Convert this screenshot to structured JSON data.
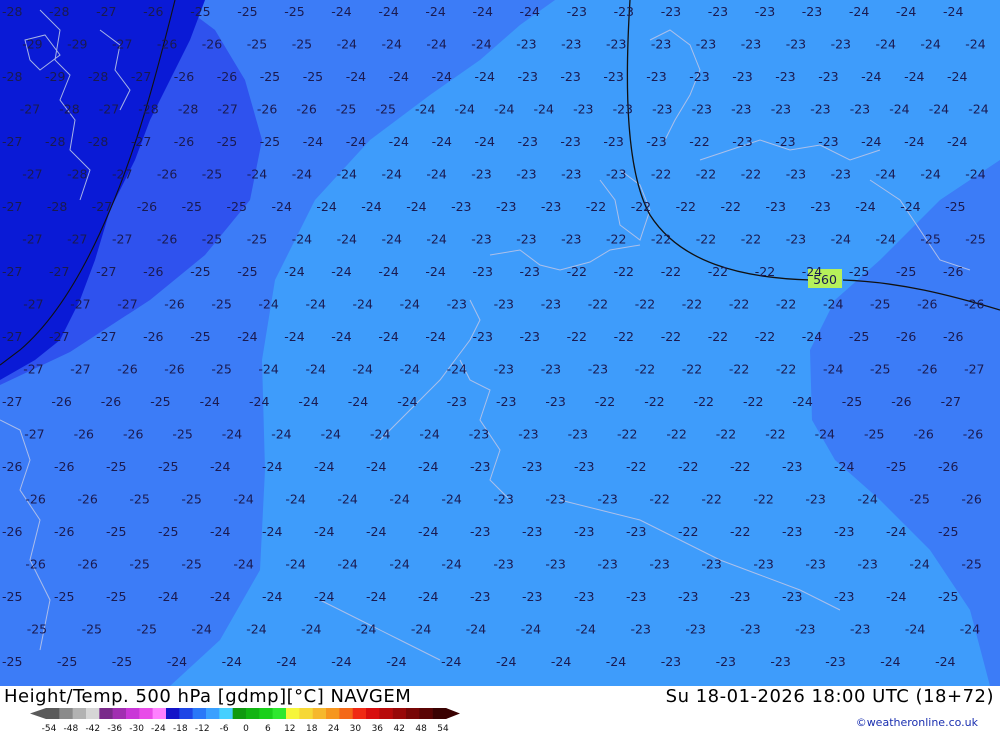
{
  "title_left": "Height/Temp. 500 hPa [gdmp][°C] NAVGEM",
  "title_right": "Su 18-01-2026 18:00 UTC (18+72)",
  "credit": "©weatheronline.co.uk",
  "height_contour_label": "560",
  "colors": {
    "ocean_dark": "#0a1ad6",
    "zone_m27": "#2f52ee",
    "zone_m24": "#3c7cf7",
    "zone_m22": "#3e9cfb",
    "contour": "#1a1a50",
    "coast": "#b8c4e8",
    "height_label_bg": "#b6f05a"
  },
  "legend": {
    "colors": [
      "#5a5a5a",
      "#8a8a8a",
      "#b2b2b2",
      "#d6d6d6",
      "#7a2a8a",
      "#a12eb1",
      "#c936d7",
      "#e84ce8",
      "#ff80ff",
      "#1414c8",
      "#1e46e6",
      "#2a78f8",
      "#3aa0ff",
      "#46d0ff",
      "#109a10",
      "#12b412",
      "#1ad01a",
      "#2ee82e",
      "#f6f63a",
      "#f6d836",
      "#f6b82c",
      "#f6961e",
      "#f46818",
      "#f02a14",
      "#d80e0e",
      "#b80a0a",
      "#980808",
      "#780606",
      "#5a0404",
      "#3a0202"
    ],
    "ticks": [
      "-54",
      "-48",
      "-42",
      "-36",
      "-30",
      "-24",
      "-18",
      "-12",
      "-6",
      "0",
      "6",
      "12",
      "18",
      "24",
      "30",
      "36",
      "42",
      "48",
      "54"
    ]
  },
  "temperature_labels": [
    {
      "row": 0,
      "values": [
        "-28",
        "-28",
        "-27",
        "-26",
        "-25",
        "-25",
        "-25",
        "-24",
        "-24",
        "-24",
        "-24",
        "-24",
        "-23",
        "-23",
        "-23",
        "-23",
        "-23",
        "-23",
        "-24",
        "-24",
        "-24"
      ]
    },
    {
      "row": 1,
      "values": [
        "-29",
        "-29",
        "-27",
        "-26",
        "-26",
        "-25",
        "-25",
        "-24",
        "-24",
        "-24",
        "-24",
        "-23",
        "-23",
        "-23",
        "-23",
        "-23",
        "-23",
        "-23",
        "-23",
        "-24",
        "-24",
        "-24"
      ]
    },
    {
      "row": 2,
      "values": [
        "-28",
        "-29",
        "-28",
        "-27",
        "-26",
        "-26",
        "-25",
        "-25",
        "-24",
        "-24",
        "-24",
        "-24",
        "-23",
        "-23",
        "-23",
        "-23",
        "-23",
        "-23",
        "-23",
        "-23",
        "-24",
        "-24",
        "-24"
      ]
    },
    {
      "row": 3,
      "values": [
        "-27",
        "-28",
        "-27",
        "-28",
        "-28",
        "-27",
        "-26",
        "-26",
        "-25",
        "-25",
        "-24",
        "-24",
        "-24",
        "-24",
        "-23",
        "-23",
        "-23",
        "-23",
        "-23",
        "-23",
        "-23",
        "-23",
        "-24",
        "-24",
        "-24"
      ]
    },
    {
      "row": 4,
      "values": [
        "-27",
        "-28",
        "-28",
        "-27",
        "-26",
        "-25",
        "-25",
        "-24",
        "-24",
        "-24",
        "-24",
        "-24",
        "-23",
        "-23",
        "-23",
        "-23",
        "-22",
        "-23",
        "-23",
        "-23",
        "-24",
        "-24",
        "-24"
      ]
    },
    {
      "row": 5,
      "values": [
        "-27",
        "-28",
        "-27",
        "-26",
        "-25",
        "-24",
        "-24",
        "-24",
        "-24",
        "-24",
        "-23",
        "-23",
        "-23",
        "-23",
        "-22",
        "-22",
        "-22",
        "-23",
        "-23",
        "-24",
        "-24",
        "-24"
      ]
    },
    {
      "row": 6,
      "values": [
        "-27",
        "-28",
        "-27",
        "-26",
        "-25",
        "-25",
        "-24",
        "-24",
        "-24",
        "-24",
        "-23",
        "-23",
        "-23",
        "-22",
        "-22",
        "-22",
        "-22",
        "-23",
        "-23",
        "-24",
        "-24",
        "-25"
      ]
    },
    {
      "row": 7,
      "values": [
        "-27",
        "-27",
        "-27",
        "-26",
        "-25",
        "-25",
        "-24",
        "-24",
        "-24",
        "-24",
        "-23",
        "-23",
        "-23",
        "-22",
        "-22",
        "-22",
        "-22",
        "-23",
        "-24",
        "-24",
        "-25",
        "-25"
      ]
    },
    {
      "row": 8,
      "values": [
        "-27",
        "-27",
        "-27",
        "-26",
        "-25",
        "-25",
        "-24",
        "-24",
        "-24",
        "-24",
        "-23",
        "-23",
        "-22",
        "-22",
        "-22",
        "-22",
        "-22",
        "-24",
        "-25",
        "-25",
        "-26"
      ]
    },
    {
      "row": 9,
      "values": [
        "-27",
        "-27",
        "-27",
        "-26",
        "-25",
        "-24",
        "-24",
        "-24",
        "-24",
        "-23",
        "-23",
        "-23",
        "-22",
        "-22",
        "-22",
        "-22",
        "-22",
        "-24",
        "-25",
        "-26",
        "-26"
      ]
    },
    {
      "row": 10,
      "values": [
        "-27",
        "-27",
        "-27",
        "-26",
        "-25",
        "-24",
        "-24",
        "-24",
        "-24",
        "-24",
        "-23",
        "-23",
        "-22",
        "-22",
        "-22",
        "-22",
        "-22",
        "-24",
        "-25",
        "-26",
        "-26"
      ]
    },
    {
      "row": 11,
      "values": [
        "-27",
        "-27",
        "-26",
        "-26",
        "-25",
        "-24",
        "-24",
        "-24",
        "-24",
        "-24",
        "-23",
        "-23",
        "-23",
        "-22",
        "-22",
        "-22",
        "-22",
        "-24",
        "-25",
        "-26",
        "-27"
      ]
    },
    {
      "row": 12,
      "values": [
        "-27",
        "-26",
        "-26",
        "-25",
        "-24",
        "-24",
        "-24",
        "-24",
        "-24",
        "-23",
        "-23",
        "-23",
        "-22",
        "-22",
        "-22",
        "-22",
        "-24",
        "-25",
        "-26",
        "-27"
      ]
    },
    {
      "row": 13,
      "values": [
        "-27",
        "-26",
        "-26",
        "-25",
        "-24",
        "-24",
        "-24",
        "-24",
        "-24",
        "-23",
        "-23",
        "-23",
        "-22",
        "-22",
        "-22",
        "-22",
        "-24",
        "-25",
        "-26",
        "-26"
      ]
    },
    {
      "row": 14,
      "values": [
        "-26",
        "-26",
        "-25",
        "-25",
        "-24",
        "-24",
        "-24",
        "-24",
        "-24",
        "-23",
        "-23",
        "-23",
        "-22",
        "-22",
        "-22",
        "-23",
        "-24",
        "-25",
        "-26"
      ]
    },
    {
      "row": 15,
      "values": [
        "-26",
        "-26",
        "-25",
        "-25",
        "-24",
        "-24",
        "-24",
        "-24",
        "-24",
        "-23",
        "-23",
        "-23",
        "-22",
        "-22",
        "-22",
        "-23",
        "-24",
        "-25",
        "-26"
      ]
    },
    {
      "row": 16,
      "values": [
        "-26",
        "-26",
        "-25",
        "-25",
        "-24",
        "-24",
        "-24",
        "-24",
        "-24",
        "-23",
        "-23",
        "-23",
        "-23",
        "-22",
        "-22",
        "-23",
        "-23",
        "-24",
        "-25"
      ]
    },
    {
      "row": 17,
      "values": [
        "-26",
        "-26",
        "-25",
        "-25",
        "-24",
        "-24",
        "-24",
        "-24",
        "-24",
        "-23",
        "-23",
        "-23",
        "-23",
        "-23",
        "-23",
        "-23",
        "-23",
        "-24",
        "-25"
      ]
    },
    {
      "row": 18,
      "values": [
        "-25",
        "-25",
        "-25",
        "-24",
        "-24",
        "-24",
        "-24",
        "-24",
        "-24",
        "-23",
        "-23",
        "-23",
        "-23",
        "-23",
        "-23",
        "-23",
        "-23",
        "-24",
        "-25"
      ]
    },
    {
      "row": 19,
      "values": [
        "-25",
        "-25",
        "-25",
        "-24",
        "-24",
        "-24",
        "-24",
        "-24",
        "-24",
        "-24",
        "-24",
        "-23",
        "-23",
        "-23",
        "-23",
        "-23",
        "-24",
        "-24"
      ]
    },
    {
      "row": 20,
      "values": [
        "-25",
        "-25",
        "-25",
        "-24",
        "-24",
        "-24",
        "-24",
        "-24",
        "-24",
        "-24",
        "-24",
        "-24",
        "-23",
        "-23",
        "-23",
        "-23",
        "-24",
        "-24"
      ]
    }
  ]
}
